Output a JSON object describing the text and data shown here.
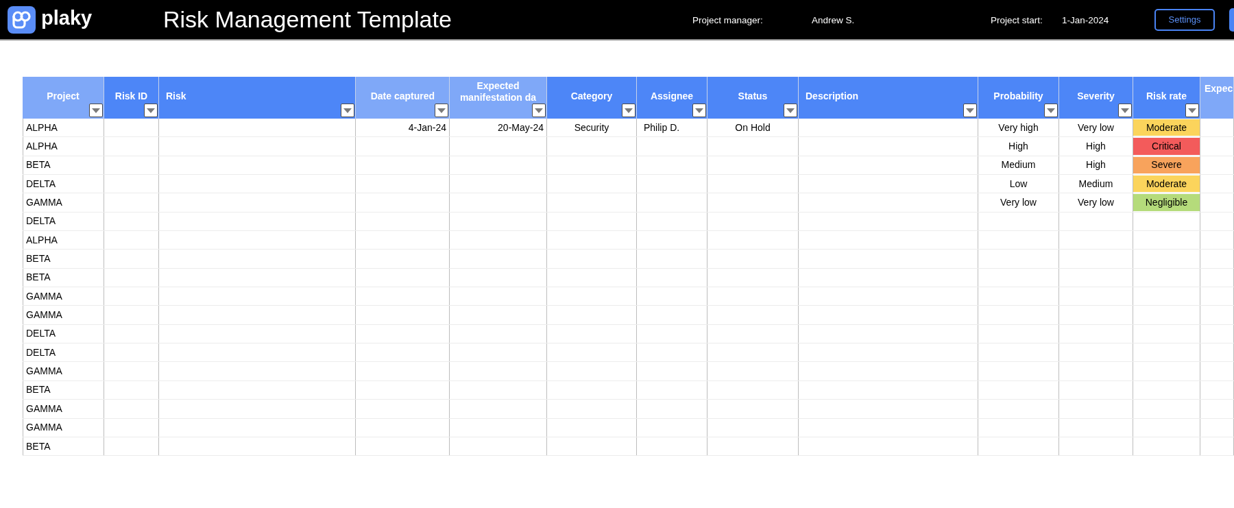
{
  "header": {
    "logo_text": "plaky",
    "title": "Risk Management Template",
    "project_manager_label": "Project manager:",
    "project_manager": "Andrew S.",
    "project_start_label": "Project start:",
    "project_start": "1-Jan-2024",
    "settings_button": "Settings"
  },
  "table": {
    "columns": [
      {
        "label": "Project",
        "color": "#7fa8f8",
        "filter": true
      },
      {
        "label": "Risk ID",
        "color": "#4d86f7",
        "filter": true
      },
      {
        "label": "Risk",
        "color": "#4d86f7",
        "filter": true
      },
      {
        "label": "Date captured",
        "color": "#7fa8f8",
        "filter": true
      },
      {
        "label": "Expected manifestation da",
        "color": "#7fa8f8",
        "filter": true
      },
      {
        "label": "Category",
        "color": "#4d86f7",
        "filter": true
      },
      {
        "label": "Assignee",
        "color": "#4d86f7",
        "filter": true
      },
      {
        "label": "Status",
        "color": "#4d86f7",
        "filter": true
      },
      {
        "label": "Description",
        "color": "#4d86f7",
        "filter": true
      },
      {
        "label": "Probability",
        "color": "#4d86f7",
        "filter": true
      },
      {
        "label": "Severity",
        "color": "#4d86f7",
        "filter": true
      },
      {
        "label": "Risk rate",
        "color": "#4d86f7",
        "filter": true
      },
      {
        "label": "Expec",
        "color": "#7fa8f8",
        "filter": false
      }
    ],
    "rows": [
      {
        "project": "ALPHA",
        "date_captured": "4-Jan-24",
        "expected_manifestation": "20-May-24",
        "category": "Security",
        "assignee": "Philip D.",
        "status": "On Hold",
        "probability": "Very high",
        "severity": "Very low",
        "risk_rate": {
          "text": "Moderate",
          "color": "#fbd45c"
        }
      },
      {
        "project": "ALPHA",
        "probability": "High",
        "severity": "High",
        "risk_rate": {
          "text": "Critical",
          "color": "#f35b5b"
        }
      },
      {
        "project": "BETA",
        "probability": "Medium",
        "severity": "High",
        "risk_rate": {
          "text": "Severe",
          "color": "#f8a35c"
        }
      },
      {
        "project": "DELTA",
        "probability": "Low",
        "severity": "Medium",
        "risk_rate": {
          "text": "Moderate",
          "color": "#fbd45c"
        }
      },
      {
        "project": "GAMMA",
        "probability": "Very low",
        "severity": "Very low",
        "risk_rate": {
          "text": "Negligible",
          "color": "#b5db7b"
        }
      },
      {
        "project": "DELTA"
      },
      {
        "project": "ALPHA"
      },
      {
        "project": "BETA"
      },
      {
        "project": "BETA"
      },
      {
        "project": "GAMMA"
      },
      {
        "project": "GAMMA"
      },
      {
        "project": "DELTA"
      },
      {
        "project": "DELTA"
      },
      {
        "project": "GAMMA"
      },
      {
        "project": "BETA"
      },
      {
        "project": "GAMMA"
      },
      {
        "project": "GAMMA"
      },
      {
        "project": "BETA"
      }
    ]
  }
}
